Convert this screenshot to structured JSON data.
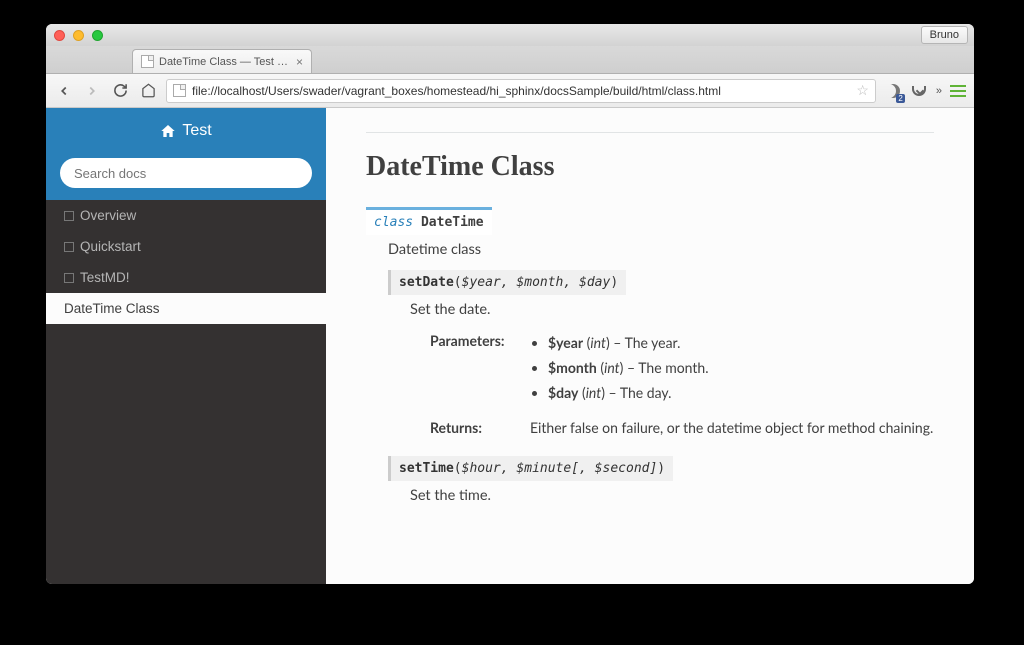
{
  "browser": {
    "user_button": "Bruno",
    "tab_title": "DateTime Class — Test 1 d",
    "url": "file://localhost/Users/swader/vagrant_boxes/homestead/hi_sphinx/docsSample/build/html/class.html",
    "badge_count": "2"
  },
  "sidebar": {
    "home_label": "Test",
    "search_placeholder": "Search docs",
    "nav": [
      {
        "label": "Overview",
        "active": false
      },
      {
        "label": "Quickstart",
        "active": false
      },
      {
        "label": "TestMD!",
        "active": false
      },
      {
        "label": "DateTime Class",
        "active": true
      }
    ]
  },
  "page": {
    "title": "DateTime Class",
    "class_keyword": "class",
    "class_name": "DateTime",
    "class_desc": "Datetime class",
    "methods": [
      {
        "sig_name": "setDate",
        "sig_params": "$year, $month, $day",
        "sig_optional": "",
        "desc": "Set the date.",
        "params_label": "Parameters:",
        "params": [
          {
            "name": "$year",
            "type": "int",
            "desc": " – The year."
          },
          {
            "name": "$month",
            "type": "int",
            "desc": " – The month."
          },
          {
            "name": "$day",
            "type": "int",
            "desc": " – The day."
          }
        ],
        "returns_label": "Returns:",
        "returns": "Either false on failure, or the datetime object for method chaining."
      },
      {
        "sig_name": "setTime",
        "sig_params": "$hour, $minute",
        "sig_optional": "[, $second]",
        "desc": "Set the time.",
        "params_label": "",
        "params": [],
        "returns_label": "",
        "returns": ""
      }
    ]
  }
}
